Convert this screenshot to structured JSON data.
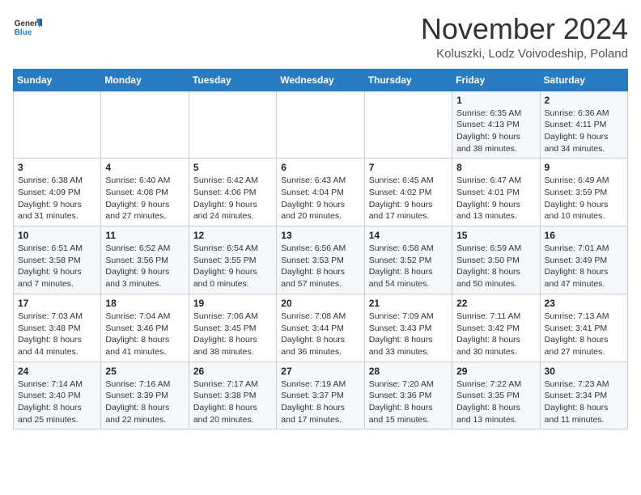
{
  "header": {
    "logo_general": "General",
    "logo_blue": "Blue",
    "month_title": "November 2024",
    "location": "Koluszki, Lodz Voivodeship, Poland"
  },
  "weekdays": [
    "Sunday",
    "Monday",
    "Tuesday",
    "Wednesday",
    "Thursday",
    "Friday",
    "Saturday"
  ],
  "weeks": [
    [
      {
        "day": "",
        "info": ""
      },
      {
        "day": "",
        "info": ""
      },
      {
        "day": "",
        "info": ""
      },
      {
        "day": "",
        "info": ""
      },
      {
        "day": "",
        "info": ""
      },
      {
        "day": "1",
        "info": "Sunrise: 6:35 AM\nSunset: 4:13 PM\nDaylight: 9 hours\nand 38 minutes."
      },
      {
        "day": "2",
        "info": "Sunrise: 6:36 AM\nSunset: 4:11 PM\nDaylight: 9 hours\nand 34 minutes."
      }
    ],
    [
      {
        "day": "3",
        "info": "Sunrise: 6:38 AM\nSunset: 4:09 PM\nDaylight: 9 hours\nand 31 minutes."
      },
      {
        "day": "4",
        "info": "Sunrise: 6:40 AM\nSunset: 4:08 PM\nDaylight: 9 hours\nand 27 minutes."
      },
      {
        "day": "5",
        "info": "Sunrise: 6:42 AM\nSunset: 4:06 PM\nDaylight: 9 hours\nand 24 minutes."
      },
      {
        "day": "6",
        "info": "Sunrise: 6:43 AM\nSunset: 4:04 PM\nDaylight: 9 hours\nand 20 minutes."
      },
      {
        "day": "7",
        "info": "Sunrise: 6:45 AM\nSunset: 4:02 PM\nDaylight: 9 hours\nand 17 minutes."
      },
      {
        "day": "8",
        "info": "Sunrise: 6:47 AM\nSunset: 4:01 PM\nDaylight: 9 hours\nand 13 minutes."
      },
      {
        "day": "9",
        "info": "Sunrise: 6:49 AM\nSunset: 3:59 PM\nDaylight: 9 hours\nand 10 minutes."
      }
    ],
    [
      {
        "day": "10",
        "info": "Sunrise: 6:51 AM\nSunset: 3:58 PM\nDaylight: 9 hours\nand 7 minutes."
      },
      {
        "day": "11",
        "info": "Sunrise: 6:52 AM\nSunset: 3:56 PM\nDaylight: 9 hours\nand 3 minutes."
      },
      {
        "day": "12",
        "info": "Sunrise: 6:54 AM\nSunset: 3:55 PM\nDaylight: 9 hours\nand 0 minutes."
      },
      {
        "day": "13",
        "info": "Sunrise: 6:56 AM\nSunset: 3:53 PM\nDaylight: 8 hours\nand 57 minutes."
      },
      {
        "day": "14",
        "info": "Sunrise: 6:58 AM\nSunset: 3:52 PM\nDaylight: 8 hours\nand 54 minutes."
      },
      {
        "day": "15",
        "info": "Sunrise: 6:59 AM\nSunset: 3:50 PM\nDaylight: 8 hours\nand 50 minutes."
      },
      {
        "day": "16",
        "info": "Sunrise: 7:01 AM\nSunset: 3:49 PM\nDaylight: 8 hours\nand 47 minutes."
      }
    ],
    [
      {
        "day": "17",
        "info": "Sunrise: 7:03 AM\nSunset: 3:48 PM\nDaylight: 8 hours\nand 44 minutes."
      },
      {
        "day": "18",
        "info": "Sunrise: 7:04 AM\nSunset: 3:46 PM\nDaylight: 8 hours\nand 41 minutes."
      },
      {
        "day": "19",
        "info": "Sunrise: 7:06 AM\nSunset: 3:45 PM\nDaylight: 8 hours\nand 38 minutes."
      },
      {
        "day": "20",
        "info": "Sunrise: 7:08 AM\nSunset: 3:44 PM\nDaylight: 8 hours\nand 36 minutes."
      },
      {
        "day": "21",
        "info": "Sunrise: 7:09 AM\nSunset: 3:43 PM\nDaylight: 8 hours\nand 33 minutes."
      },
      {
        "day": "22",
        "info": "Sunrise: 7:11 AM\nSunset: 3:42 PM\nDaylight: 8 hours\nand 30 minutes."
      },
      {
        "day": "23",
        "info": "Sunrise: 7:13 AM\nSunset: 3:41 PM\nDaylight: 8 hours\nand 27 minutes."
      }
    ],
    [
      {
        "day": "24",
        "info": "Sunrise: 7:14 AM\nSunset: 3:40 PM\nDaylight: 8 hours\nand 25 minutes."
      },
      {
        "day": "25",
        "info": "Sunrise: 7:16 AM\nSunset: 3:39 PM\nDaylight: 8 hours\nand 22 minutes."
      },
      {
        "day": "26",
        "info": "Sunrise: 7:17 AM\nSunset: 3:38 PM\nDaylight: 8 hours\nand 20 minutes."
      },
      {
        "day": "27",
        "info": "Sunrise: 7:19 AM\nSunset: 3:37 PM\nDaylight: 8 hours\nand 17 minutes."
      },
      {
        "day": "28",
        "info": "Sunrise: 7:20 AM\nSunset: 3:36 PM\nDaylight: 8 hours\nand 15 minutes."
      },
      {
        "day": "29",
        "info": "Sunrise: 7:22 AM\nSunset: 3:35 PM\nDaylight: 8 hours\nand 13 minutes."
      },
      {
        "day": "30",
        "info": "Sunrise: 7:23 AM\nSunset: 3:34 PM\nDaylight: 8 hours\nand 11 minutes."
      }
    ]
  ]
}
